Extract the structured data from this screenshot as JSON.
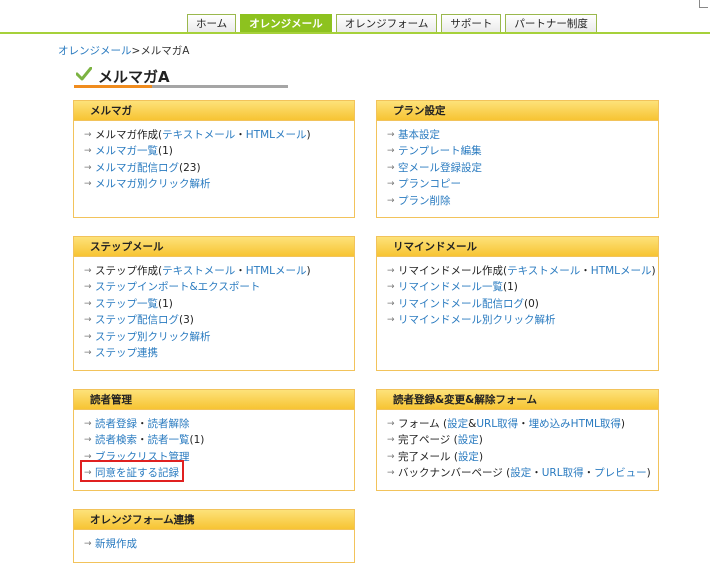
{
  "nav": {
    "tabs": [
      {
        "label": "ホーム",
        "active": false
      },
      {
        "label": "オレンジメール",
        "active": true
      },
      {
        "label": "オレンジフォーム",
        "active": false
      },
      {
        "label": "サポート",
        "active": false
      },
      {
        "label": "パートナー制度",
        "active": false
      }
    ]
  },
  "breadcrumb": {
    "parent": "オレンジメール",
    "separator": ">",
    "current": "メルマガA"
  },
  "page_title": "メルマガA",
  "panels": {
    "mailmag": {
      "title": "メルマガ",
      "items": [
        {
          "parts": [
            {
              "t": "メルマガ作成(",
              "link": false
            },
            {
              "t": "テキストメール",
              "link": true
            },
            {
              "t": "・",
              "link": false
            },
            {
              "t": "HTMLメール",
              "link": true
            },
            {
              "t": ")",
              "link": false
            }
          ]
        },
        {
          "parts": [
            {
              "t": "メルマガ一覧",
              "link": true
            },
            {
              "t": " (1)",
              "link": false
            }
          ]
        },
        {
          "parts": [
            {
              "t": "メルマガ配信ログ",
              "link": true
            },
            {
              "t": " (23)",
              "link": false
            }
          ]
        },
        {
          "parts": [
            {
              "t": "メルマガ別クリック解析",
              "link": true
            }
          ]
        }
      ]
    },
    "plan": {
      "title": "プラン設定",
      "items": [
        {
          "parts": [
            {
              "t": "基本設定",
              "link": true
            }
          ]
        },
        {
          "parts": [
            {
              "t": "テンプレート編集",
              "link": true
            }
          ]
        },
        {
          "parts": [
            {
              "t": "空メール登録設定",
              "link": true
            }
          ]
        },
        {
          "parts": [
            {
              "t": "プランコピー",
              "link": true
            }
          ]
        },
        {
          "parts": [
            {
              "t": "プラン削除",
              "link": true
            }
          ]
        }
      ]
    },
    "step": {
      "title": "ステップメール",
      "items": [
        {
          "parts": [
            {
              "t": "ステップ作成(",
              "link": false
            },
            {
              "t": "テキストメール",
              "link": true
            },
            {
              "t": "・",
              "link": false
            },
            {
              "t": "HTMLメール",
              "link": true
            },
            {
              "t": ")",
              "link": false
            }
          ]
        },
        {
          "parts": [
            {
              "t": "ステップインポート&エクスポート",
              "link": true
            }
          ]
        },
        {
          "parts": [
            {
              "t": "ステップ一覧",
              "link": true
            },
            {
              "t": " (1)",
              "link": false
            }
          ]
        },
        {
          "parts": [
            {
              "t": "ステップ配信ログ",
              "link": true
            },
            {
              "t": " (3)",
              "link": false
            }
          ]
        },
        {
          "parts": [
            {
              "t": "ステップ別クリック解析",
              "link": true
            }
          ]
        },
        {
          "parts": [
            {
              "t": "ステップ連携",
              "link": true
            }
          ]
        }
      ]
    },
    "remind": {
      "title": "リマインドメール",
      "items": [
        {
          "parts": [
            {
              "t": "リマインドメール作成(",
              "link": false
            },
            {
              "t": "テキストメール",
              "link": true
            },
            {
              "t": "・",
              "link": false
            },
            {
              "t": "HTMLメール",
              "link": true
            },
            {
              "t": ")",
              "link": false
            }
          ]
        },
        {
          "parts": [
            {
              "t": "リマインドメール一覧",
              "link": true
            },
            {
              "t": " (1)",
              "link": false
            }
          ]
        },
        {
          "parts": [
            {
              "t": "リマインドメール配信ログ",
              "link": true
            },
            {
              "t": " (0)",
              "link": false
            }
          ]
        },
        {
          "parts": [
            {
              "t": "リマインドメール別クリック解析",
              "link": true
            }
          ]
        }
      ]
    },
    "reader": {
      "title": "読者管理",
      "items": [
        {
          "parts": [
            {
              "t": "読者登録",
              "link": true
            },
            {
              "t": "・",
              "link": false
            },
            {
              "t": "読者解除",
              "link": true
            }
          ]
        },
        {
          "parts": [
            {
              "t": "読者検索",
              "link": true
            },
            {
              "t": "・",
              "link": false
            },
            {
              "t": "読者一覧",
              "link": true
            },
            {
              "t": " (1)",
              "link": false
            }
          ]
        },
        {
          "parts": [
            {
              "t": "ブラックリスト管理",
              "link": true
            }
          ]
        },
        {
          "parts": [
            {
              "t": "同意を証する記録",
              "link": true
            }
          ]
        }
      ]
    },
    "form": {
      "title": "読者登録&変更&解除フォーム",
      "items": [
        {
          "parts": [
            {
              "t": "フォーム (",
              "link": false
            },
            {
              "t": "設定",
              "link": true
            },
            {
              "t": "&",
              "link": false
            },
            {
              "t": "URL取得",
              "link": true
            },
            {
              "t": "・",
              "link": false
            },
            {
              "t": "埋め込みHTML取得",
              "link": true
            },
            {
              "t": ")",
              "link": false
            }
          ]
        },
        {
          "parts": [
            {
              "t": "完了ページ (",
              "link": false
            },
            {
              "t": "設定",
              "link": true
            },
            {
              "t": ")",
              "link": false
            }
          ]
        },
        {
          "parts": [
            {
              "t": "完了メール (",
              "link": false
            },
            {
              "t": "設定",
              "link": true
            },
            {
              "t": ")",
              "link": false
            }
          ]
        },
        {
          "parts": [
            {
              "t": "バックナンバーページ (",
              "link": false
            },
            {
              "t": "設定",
              "link": true
            },
            {
              "t": "・",
              "link": false
            },
            {
              "t": "URL取得",
              "link": true
            },
            {
              "t": "・",
              "link": false
            },
            {
              "t": "プレビュー",
              "link": true
            },
            {
              "t": ")",
              "link": false
            }
          ]
        }
      ]
    },
    "orangeform": {
      "title": "オレンジフォーム連携",
      "items": [
        {
          "parts": [
            {
              "t": "新規作成",
              "link": true
            }
          ]
        }
      ]
    }
  },
  "colors": {
    "nav_accent": "#8dc21f",
    "panel_header": "#f7c433",
    "link": "#2a7bc0",
    "highlight": "#e02020",
    "title_accent": "#f08c1e"
  }
}
